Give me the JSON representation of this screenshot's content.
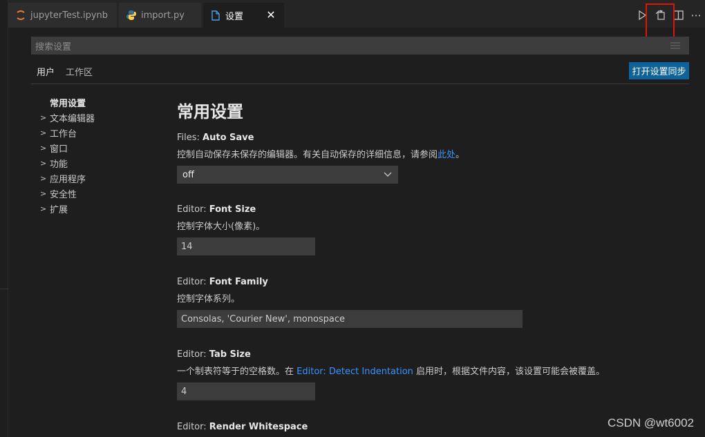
{
  "tabs": [
    {
      "label": "jupyterTest.ipynb",
      "icon": "jupyter-icon",
      "active": false
    },
    {
      "label": "import.py",
      "icon": "python-icon",
      "active": false
    },
    {
      "label": "设置",
      "icon": "file-icon",
      "active": true
    }
  ],
  "editor_actions": [
    "run-icon",
    "open-settings-json-icon",
    "split-editor-icon",
    "more-actions-icon"
  ],
  "search": {
    "placeholder": "搜索设置"
  },
  "scopes": {
    "user": "用户",
    "workspace": "工作区"
  },
  "sync_button": "打开设置同步",
  "toc": {
    "header": "常用设置",
    "items": [
      "文本编辑器",
      "工作台",
      "窗口",
      "功能",
      "应用程序",
      "安全性",
      "扩展"
    ]
  },
  "section_title": "常用设置",
  "settings": {
    "auto_save": {
      "category": "Files: ",
      "key": "Auto Save",
      "desc_before": "控制自动保存未保存的编辑器。有关自动保存的详细信息，请参阅",
      "desc_link": "此处",
      "desc_after": "。",
      "value": "off"
    },
    "font_size": {
      "category": "Editor: ",
      "key": "Font Size",
      "desc": "控制字体大小(像素)。",
      "value": "14"
    },
    "font_family": {
      "category": "Editor: ",
      "key": "Font Family",
      "desc": "控制字体系列。",
      "value": "Consolas, 'Courier New', monospace"
    },
    "tab_size": {
      "category": "Editor: ",
      "key": "Tab Size",
      "desc_before": "一个制表符等于的空格数。在 ",
      "desc_link": "Editor: Detect Indentation",
      "desc_after": " 启用时，根据文件内容，该设置可能会被覆盖。",
      "value": "4"
    },
    "render_whitespace": {
      "category": "Editor: ",
      "key": "Render Whitespace"
    }
  },
  "watermark": "CSDN @wt6002",
  "colors": {
    "accent": "#0e639c",
    "link": "#3794ff",
    "highlight": "#e51400"
  }
}
